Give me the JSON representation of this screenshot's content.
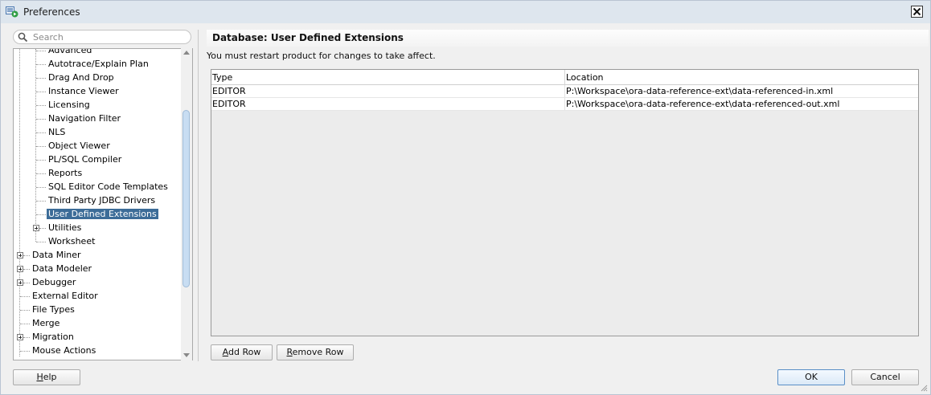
{
  "window": {
    "title": "Preferences"
  },
  "search": {
    "placeholder": "Search"
  },
  "tree": {
    "items": [
      {
        "label": "Advanced"
      },
      {
        "label": "Autotrace/Explain Plan"
      },
      {
        "label": "Drag And Drop"
      },
      {
        "label": "Instance Viewer"
      },
      {
        "label": "Licensing"
      },
      {
        "label": "Navigation Filter"
      },
      {
        "label": "NLS"
      },
      {
        "label": "Object Viewer"
      },
      {
        "label": "PL/SQL Compiler"
      },
      {
        "label": "Reports"
      },
      {
        "label": "SQL Editor Code Templates"
      },
      {
        "label": "Third Party JDBC Drivers"
      },
      {
        "label": "User Defined Extensions",
        "selected": true
      },
      {
        "label": "Utilities",
        "expandable": true
      },
      {
        "label": "Worksheet"
      },
      {
        "label": "Data Miner",
        "expandable": true
      },
      {
        "label": "Data Modeler",
        "expandable": true
      },
      {
        "label": "Debugger",
        "expandable": true
      },
      {
        "label": "External Editor"
      },
      {
        "label": "File Types"
      },
      {
        "label": "Merge"
      },
      {
        "label": "Migration",
        "expandable": true
      },
      {
        "label": "Mouse Actions"
      }
    ]
  },
  "panel": {
    "title": "Database: User Defined Extensions",
    "notice": "You must restart product for changes to take affect."
  },
  "table": {
    "columns": [
      "Type",
      "Location"
    ],
    "rows": [
      [
        "EDITOR",
        "P:\\Workspace\\ora-data-reference-ext\\data-referenced-in.xml"
      ],
      [
        "EDITOR",
        "P:\\Workspace\\ora-data-reference-ext\\data-referenced-out.xml"
      ]
    ]
  },
  "buttons": {
    "add_row": "Add Row",
    "remove_row": "Remove Row",
    "help": "Help",
    "ok": "OK",
    "cancel": "Cancel"
  },
  "colors": {
    "selection": "#3c6c98",
    "titlebar": "#dee6ee",
    "accent_border": "#5a8fc7"
  }
}
